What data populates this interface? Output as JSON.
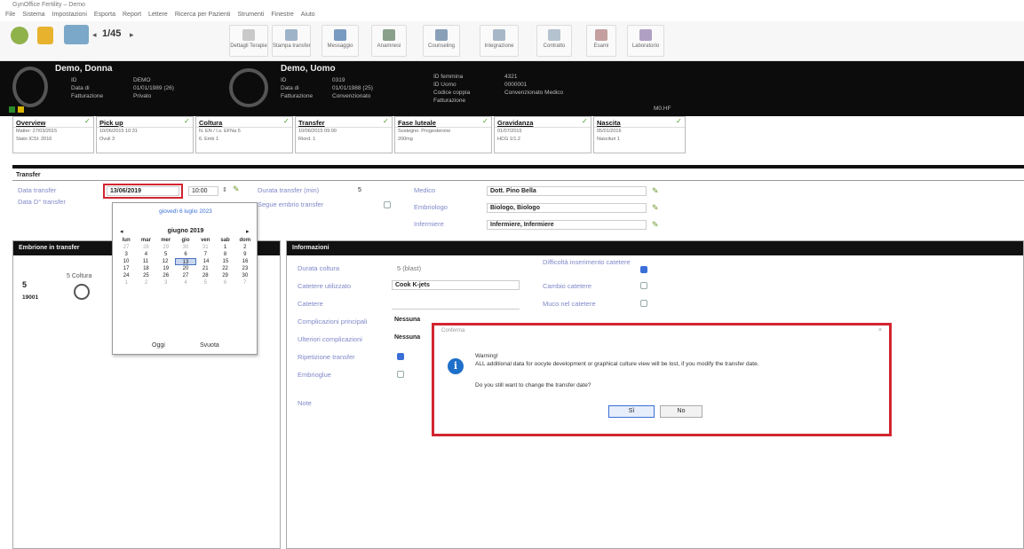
{
  "titlebar": {
    "title": "GynOffice Fertility – Demo"
  },
  "menu": [
    "File",
    "Sistema",
    "Impostazioni",
    "Esporta",
    "Report",
    "Lettere",
    "Ricerca per Pazienti",
    "Strumenti",
    "Finestre",
    "Aiuto"
  ],
  "toolbar": {
    "counter": "1/45",
    "buttons": [
      "Dettagli Terapie",
      "Stampa transfer",
      "Messaggio",
      "Anamnesi",
      "Counseling",
      "Integrazione",
      "Contratto",
      "Esami",
      "Laboratorio"
    ]
  },
  "patient": {
    "female_name": "Demo, Donna",
    "female_id_label": "ID",
    "female_id": "DEMO",
    "female_dob_label": "Data di",
    "female_dob": "01/01/1989 (26)",
    "female_billing_label": "Fatturazione",
    "female_billing": "Privato",
    "male_name": "Demo, Uomo",
    "male_id_label": "ID",
    "male_id": "0319",
    "male_dob_label": "Data di",
    "male_dob": "01/01/1988 (25)",
    "male_billing_label": "Fatturazione",
    "male_billing": "Convenzionato",
    "extra_labels": [
      "ID femmina",
      "ID Uomo",
      "Codice coppia",
      "Fatturazione"
    ],
    "extra_values": [
      "4321",
      "",
      "0000001",
      "Convenzionato Medico"
    ],
    "extra_tag": "M0.HF"
  },
  "cards": [
    {
      "title": "Overview",
      "lines": [
        "Matter: 27/03/2015",
        "Stato ICSI: 2016"
      ]
    },
    {
      "title": "Pick up",
      "lines": [
        "10/06/2015 10:31",
        "Ovuli 3"
      ]
    },
    {
      "title": "Coltura",
      "lines": [
        "N. EN / I.s. EFNa 5",
        "6. Emb 1"
      ]
    },
    {
      "title": "Transfer",
      "lines": [
        "10/06/2015 09:00",
        "Riord. 1"
      ]
    },
    {
      "title": "Fase luteale",
      "lines": [
        "Sostegno: Progesterone",
        "200mg"
      ]
    },
    {
      "title": "Gravidanza",
      "lines": [
        "01/07/2015",
        "HCG 1/1.2"
      ]
    },
    {
      "title": "Nascita",
      "lines": [
        "05/01/2016",
        "Nascituri 1"
      ]
    }
  ],
  "section": {
    "title": "Transfer"
  },
  "form": {
    "date_transfer_label": "Data transfer",
    "date_transfer_value": "13/06/2019",
    "time_value": "10:00",
    "date_d7_label": "Data D° transfer",
    "duration_label": "Durata transfer (min)",
    "duration_value": "5",
    "follow_label": "Segue embrio transfer",
    "doctor_label": "Medico",
    "doctor_value": "Dott. Pino Bella",
    "embryologist_label": "Embriologo",
    "embryologist_value": "Biologo, Biologo",
    "nurse_label": "Infermiere",
    "nurse_value": "Infermiere, Infermiere"
  },
  "calendar": {
    "today_text": "giovedì 6 luglio 2023",
    "month": "giugno 2019",
    "prev": "◂",
    "next": "▸",
    "weekdays": [
      "lun",
      "mar",
      "mer",
      "gio",
      "ven",
      "sab",
      "dom"
    ],
    "rows": [
      [
        "27",
        "28",
        "29",
        "30",
        "31",
        "1",
        "2"
      ],
      [
        "3",
        "4",
        "5",
        "6",
        "7",
        "8",
        "9"
      ],
      [
        "10",
        "11",
        "12",
        "13",
        "14",
        "15",
        "16"
      ],
      [
        "17",
        "18",
        "19",
        "20",
        "21",
        "22",
        "23"
      ],
      [
        "24",
        "25",
        "26",
        "27",
        "28",
        "29",
        "30"
      ],
      [
        "1",
        "2",
        "3",
        "4",
        "5",
        "6",
        "7"
      ]
    ],
    "selected": "13",
    "today_btn": "Oggi",
    "clear_btn": "Svuota"
  },
  "leftpane": {
    "title": "Embrione in transfer",
    "col": "5 Coltura",
    "num": "5",
    "id": "19001"
  },
  "rightpane": {
    "title": "Informazioni",
    "labels": [
      "Durata coltura",
      "Catetere utilizzato",
      "Catetere",
      "Complicazioni principali",
      "Ulteriori complicazioni",
      "Ripetizione transfer",
      "Embrioglue",
      "Note"
    ],
    "coltura_value": "5 (blast)",
    "catetere_value": "Cook K-jets",
    "complicazioni_value": "Nessuna",
    "ulteriori_value": "Nessuna",
    "right_labels": [
      "Difficoltà inserimento catetere",
      "Cambio catetere",
      "Muco nel catetere"
    ]
  },
  "dialog": {
    "title": "Conferma",
    "close": "×",
    "line1": "Warning!",
    "line2": "ALL additional data for oocyte development or graphical culture view will be lost, if you modify the transfer date.",
    "line3": "Do you still want to change the transfer date?",
    "yes": "Sì",
    "no": "No"
  }
}
